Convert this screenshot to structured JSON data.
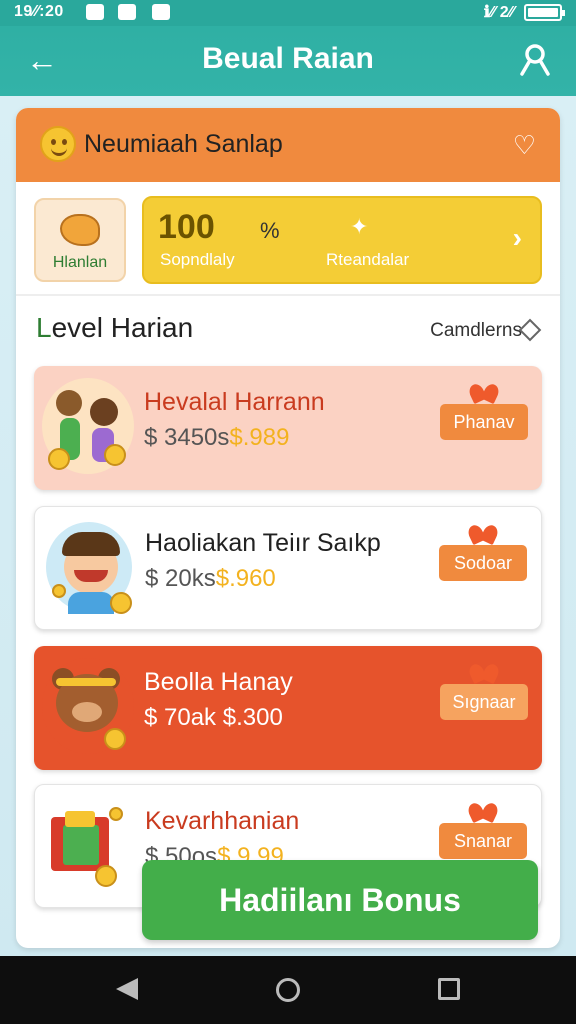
{
  "status_bar": {
    "time": "19∕∕:20",
    "right_text": "ℹ∕∕ 2∕∕"
  },
  "app_bar": {
    "back_icon": "arrow-left-icon",
    "title": "Beual Raian",
    "user_icon": "user-icon"
  },
  "profile": {
    "name": "Neumiaah Sanlap",
    "heart_icon": "heart-icon"
  },
  "tiles": {
    "left_label": "Hlanlan",
    "points_value": "100",
    "points_symbol": "%",
    "points_sublabel": "Sopndlaly",
    "reward_sublabel": "Rteandalar"
  },
  "level": {
    "title_first": "L",
    "title_rest": "evel Harian",
    "calendar_label": "Camdlerns"
  },
  "rewards": [
    {
      "title": "Hevalal Harrann",
      "value_main": "$ 3450s",
      "value_accent": "$.989",
      "button": "Phanav"
    },
    {
      "title": "Haoliakan Teiır Saıkp",
      "value_main": "$ 20ks",
      "value_accent": "$.960",
      "button": "Sodoar"
    },
    {
      "title": "Beolla Hanay",
      "value_main": "$ 70ak $.300",
      "value_accent": "",
      "button": "Sıgnaar"
    },
    {
      "title": "Kevarhhanian",
      "value_main": "$ 50os",
      "value_accent": "$ 9.99",
      "button": "Snanar"
    }
  ],
  "bonus_button": "Hadiilanı Bonus",
  "colors": {
    "teal": "#2fb0a4",
    "orange": "#f08a3e",
    "yellow": "#f4cd36",
    "green": "#43ae4a",
    "red": "#e6532c"
  }
}
